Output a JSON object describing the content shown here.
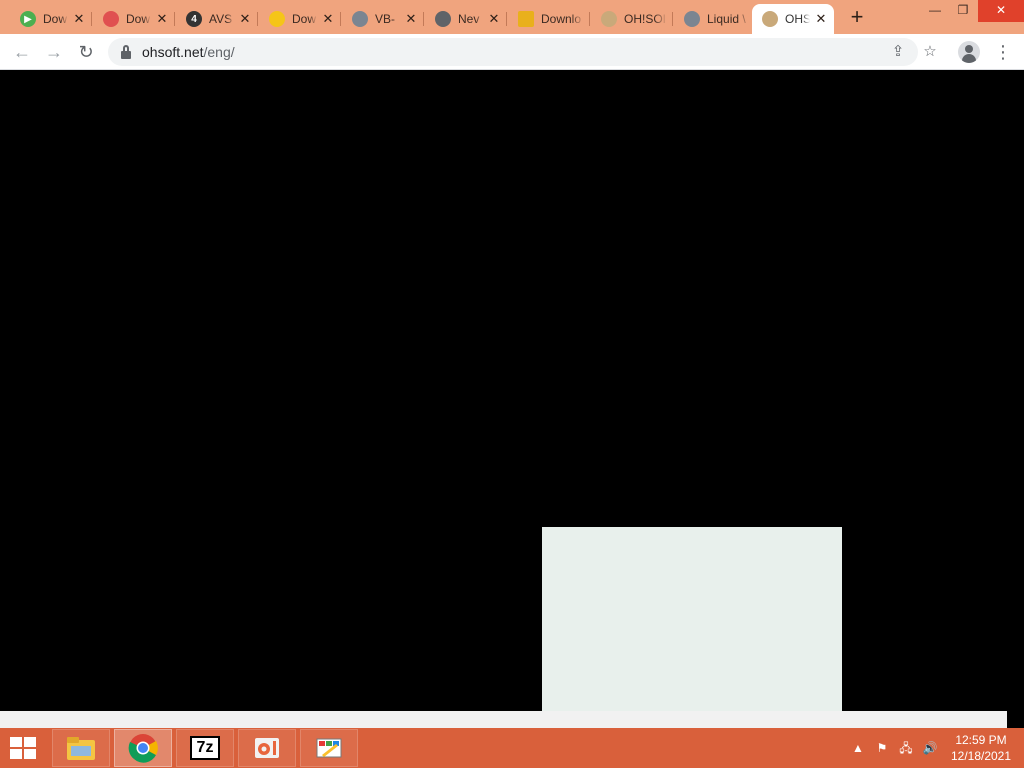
{
  "browser": {
    "tabs": [
      {
        "title": "Dow",
        "favicon_color": "#4caf50",
        "favicon": "dl-green-icon"
      },
      {
        "title": "Dow",
        "favicon_color": "#e05050",
        "favicon": "dl-red-icon"
      },
      {
        "title": "AVS",
        "favicon_color": "#333333",
        "favicon": "avs-4-icon",
        "glyph": "4"
      },
      {
        "title": "Dow",
        "favicon_color": "#f5c518",
        "favicon": "dl-yellow-icon"
      },
      {
        "title": "VB-",
        "favicon_color": "#7b8591",
        "favicon": "globe-icon"
      },
      {
        "title": "Nev",
        "favicon_color": "#5f6368",
        "favicon": "chrome-icon"
      },
      {
        "title": "Downlo",
        "favicon_color": "#e9b01c",
        "favicon": "dl-ribbon-icon"
      },
      {
        "title": "OH!SOI",
        "favicon_color": "#c9a97a",
        "favicon": "ohsoft-icon"
      },
      {
        "title": "Liquid \\",
        "favicon_color": "#7b8591",
        "favicon": "globe-icon"
      },
      {
        "title": "OHS",
        "favicon_color": "#c9a97a",
        "favicon": "ohsoft-icon",
        "active": true
      }
    ],
    "address": {
      "host": "ohsoft.net",
      "path": "/eng/"
    }
  },
  "taskbar": {
    "apps": [
      {
        "name": "file-explorer"
      },
      {
        "name": "chrome",
        "active": true
      },
      {
        "name": "7zip",
        "label": "7z"
      },
      {
        "name": "ohsoft-app"
      },
      {
        "name": "paint-app"
      }
    ],
    "clock": {
      "time": "12:59 PM",
      "date": "12/18/2021"
    }
  }
}
